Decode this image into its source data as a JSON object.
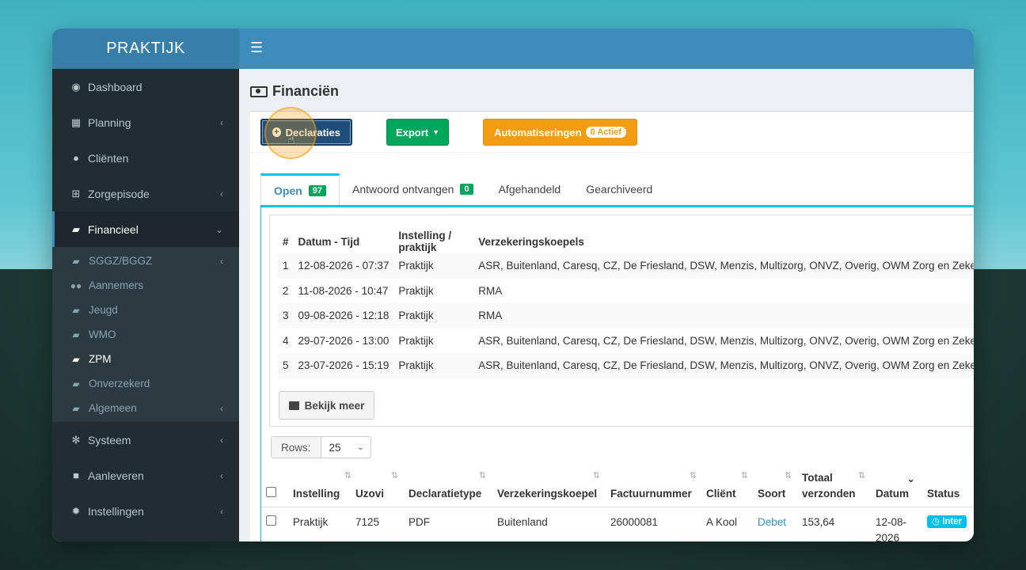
{
  "app": {
    "logo": "PRAKTIJK"
  },
  "sidebar": {
    "items": [
      {
        "label": "Dashboard",
        "icon": "dashboard-icon"
      },
      {
        "label": "Planning",
        "icon": "calendar-icon"
      },
      {
        "label": "Cliënten",
        "icon": "user-icon"
      },
      {
        "label": "Zorgepisode",
        "icon": "medkit-icon"
      },
      {
        "label": "Financieel",
        "icon": "book-icon"
      },
      {
        "label": "Systeem",
        "icon": "cogs-icon"
      },
      {
        "label": "Aanleveren",
        "icon": "truck-icon"
      },
      {
        "label": "Instellingen",
        "icon": "gear-icon"
      }
    ],
    "sub_items": [
      {
        "label": "SGGZ/BGGZ"
      },
      {
        "label": "Aannemers"
      },
      {
        "label": "Jeugd"
      },
      {
        "label": "WMO"
      },
      {
        "label": "ZPM"
      },
      {
        "label": "Onverzekerd"
      },
      {
        "label": "Algemeen"
      }
    ]
  },
  "page": {
    "title": "Financiën"
  },
  "toolbar": {
    "declaraties": "Declaraties",
    "export": "Export",
    "automatiseringen": "Automatiseringen",
    "actief_badge": "0 Actief"
  },
  "tabs": [
    {
      "label": "Open",
      "count": "97"
    },
    {
      "label": "Antwoord ontvangen",
      "count": "0"
    },
    {
      "label": "Afgehandeld"
    },
    {
      "label": "Gearchiveerd"
    }
  ],
  "recent": {
    "headers": [
      "#",
      "Datum - Tijd",
      "Instelling / praktijk",
      "Verzekeringskoepels"
    ],
    "rows": [
      [
        "1",
        "12-08-2026 - 07:37",
        "Praktijk",
        "ASR, Buitenland, Caresq, CZ, De Friesland, DSW, Menzis, Multizorg, ONVZ, Overig, OWM Zorg en Zekerh"
      ],
      [
        "2",
        "11-08-2026 - 10:47",
        "Praktijk",
        "RMA"
      ],
      [
        "3",
        "09-08-2026 - 12:18",
        "Praktijk",
        "RMA"
      ],
      [
        "4",
        "29-07-2026 - 13:00",
        "Praktijk",
        "ASR, Buitenland, Caresq, CZ, De Friesland, DSW, Menzis, Multizorg, ONVZ, Overig, OWM Zorg en Zekerh"
      ],
      [
        "5",
        "23-07-2026 - 15:19",
        "Praktijk",
        "ASR, Buitenland, Caresq, CZ, De Friesland, DSW, Menzis, Multizorg, ONVZ, Overig, OWM Zorg en Zekerh"
      ]
    ],
    "more_button": "Bekijk meer"
  },
  "rows_control": {
    "label": "Rows:",
    "value": "25"
  },
  "table": {
    "headers": {
      "instelling": "Instelling",
      "uzovi": "Uzovi",
      "declaratietype": "Declaratietype",
      "koepel": "Verzekeringskoepel",
      "factuurnummer": "Factuurnummer",
      "client": "Cliënt",
      "soort": "Soort",
      "totaal_1": "Totaal",
      "totaal_2": "verzonden",
      "datum": "Datum",
      "status": "Status"
    },
    "row1": {
      "instelling": "Praktijk",
      "uzovi": "7125",
      "declaratietype": "PDF",
      "koepel": "Buitenland",
      "factuurnummer": "26000081",
      "client": "A Kool",
      "soort": "Debet",
      "totaal": "153,64",
      "datum_1": "12-08-",
      "datum_2": "2026",
      "status": "Inter"
    }
  },
  "colors": {
    "primary": "#3c8dbc",
    "success": "#00a65a",
    "warning": "#f39c12",
    "info": "#00c0ef",
    "sidebar": "#222d32"
  }
}
